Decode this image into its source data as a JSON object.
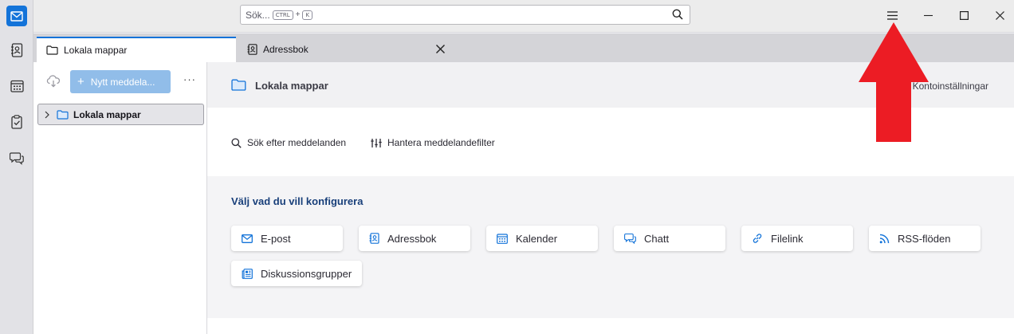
{
  "search": {
    "placeholder": "Sök...",
    "kbd_ctrl": "CTRL",
    "kbd_plus": "+",
    "kbd_key": "K"
  },
  "spaces": [
    "mail-icon",
    "address-book-icon",
    "calendar-icon",
    "tasks-icon",
    "chat-icon"
  ],
  "tabs": [
    {
      "label": "Lokala mappar",
      "icon": "folder-icon"
    },
    {
      "label": "Adressbok",
      "icon": "address-book-icon"
    }
  ],
  "folder_pane": {
    "new_message_label": "Nytt meddela...",
    "more_label": "···",
    "folders": [
      {
        "label": "Lokala mappar"
      }
    ]
  },
  "main": {
    "account_title": "Lokala mappar",
    "account_settings": "Kontoinställningar",
    "actions": [
      {
        "label": "Sök efter meddelanden",
        "icon": "search-icon"
      },
      {
        "label": "Hantera meddelandefilter",
        "icon": "filter-icon"
      }
    ],
    "configure_title": "Välj vad du vill konfigurera",
    "cards": [
      {
        "label": "E-post",
        "icon": "mail-icon"
      },
      {
        "label": "Adressbok",
        "icon": "address-book-icon"
      },
      {
        "label": "Kalender",
        "icon": "calendar-icon"
      },
      {
        "label": "Chatt",
        "icon": "chat-icon"
      },
      {
        "label": "Filelink",
        "icon": "link-icon"
      },
      {
        "label": "RSS-flöden",
        "icon": "rss-icon"
      },
      {
        "label": "Diskussionsgrupper",
        "icon": "newsgroup-icon"
      }
    ]
  },
  "colors": {
    "accent": "#1373d9",
    "annotation_arrow": "#ec1c24"
  }
}
